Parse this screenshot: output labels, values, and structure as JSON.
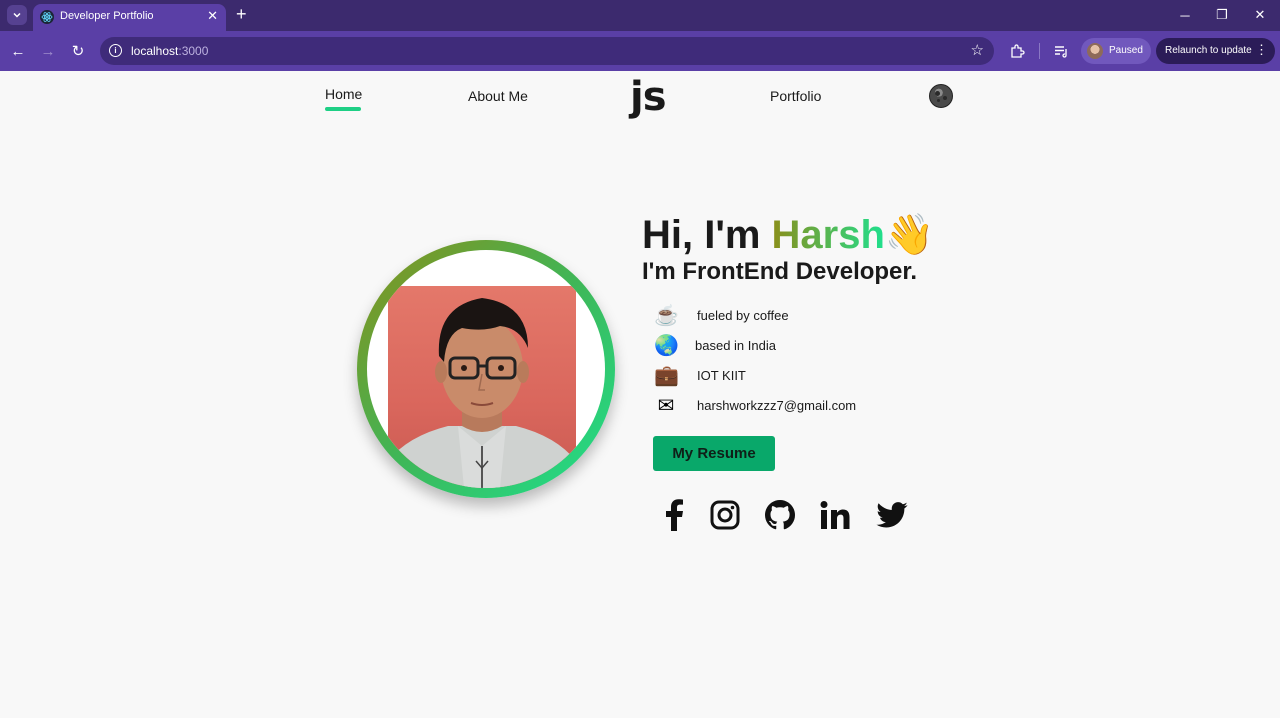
{
  "browser": {
    "tab_title": "Developer Portfolio",
    "url_host": "localhost",
    "url_port": ":3000",
    "profile_label": "Paused",
    "relaunch_label": "Relaunch to update"
  },
  "nav": {
    "items": [
      {
        "label": "Home",
        "active": true
      },
      {
        "label": "About Me",
        "active": false
      },
      {
        "label": "Portfolio",
        "active": false
      }
    ],
    "logo": "js",
    "theme_toggle_icon": "moon-icon"
  },
  "hero": {
    "greeting_prefix": "Hi, I'm ",
    "name": "Harsh",
    "wave_emoji": "👋",
    "subtitle": "I'm FrontEnd Developer.",
    "details": [
      {
        "icon": "coffee-icon",
        "emoji": "☕",
        "text": "fueled by coffee"
      },
      {
        "icon": "globe-icon",
        "emoji": "🌏",
        "text": "based in India"
      },
      {
        "icon": "briefcase-icon",
        "emoji": "💼",
        "text": "IOT KIIT"
      },
      {
        "icon": "email-icon",
        "emoji": "✉",
        "text": "harshworkzzz7@gmail.com"
      }
    ],
    "resume_label": "My Resume",
    "socials": [
      "facebook-icon",
      "instagram-icon",
      "github-icon",
      "linkedin-icon",
      "twitter-icon"
    ]
  },
  "colors": {
    "accent_green": "#09a86a",
    "underline_green": "#1ecf85",
    "gradient_start": "#8a8f1a",
    "gradient_end": "#1fe08e",
    "browser_purple": "#5a3fa6"
  }
}
